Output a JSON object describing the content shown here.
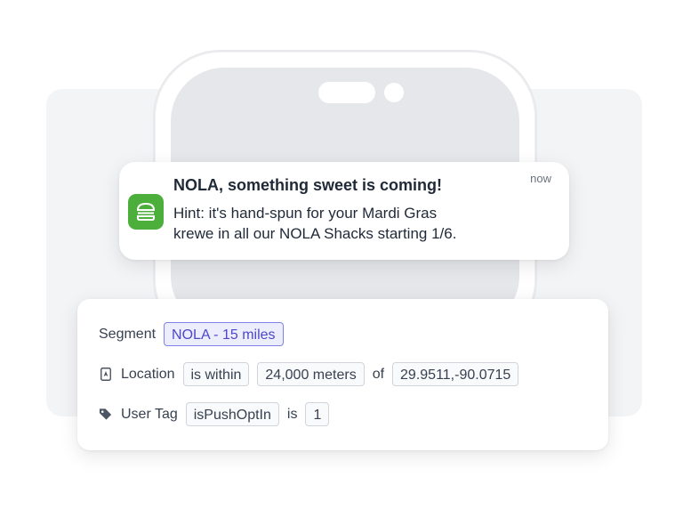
{
  "notification": {
    "title": "NOLA, something sweet is coming!",
    "time": "now",
    "body_line1": "Hint: it's hand-spun for your Mardi Gras",
    "body_line2": "krewe in all our NOLA Shacks starting 1/6.",
    "app_icon": "burger-icon",
    "app_icon_color": "#4cae3b"
  },
  "segment": {
    "label": "Segment",
    "name": "NOLA - 15 miles",
    "accent_color": "#4f46c8"
  },
  "location_rule": {
    "icon": "location-icon",
    "label": "Location",
    "operator": "is within",
    "distance": "24,000 meters",
    "connector": "of",
    "coordinates": "29.9511,-90.0715"
  },
  "tag_rule": {
    "icon": "tag-icon",
    "label": "User Tag",
    "tag_name": "isPushOptIn",
    "connector": "is",
    "value": "1"
  }
}
